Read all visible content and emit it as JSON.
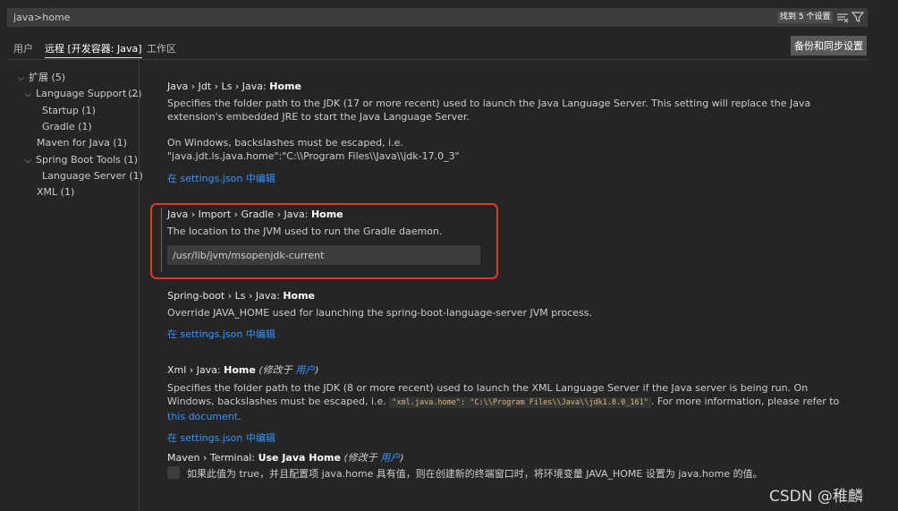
{
  "search": {
    "value": "java>home",
    "result_count": "找到 5 个设置",
    "clear_filter_icon": "clear-filter-icon",
    "filter_icon": "filter-icon"
  },
  "tabs": [
    {
      "label": "用户",
      "active": false
    },
    {
      "label": "远程 [开发容器: Java]",
      "active": true
    },
    {
      "label": "工作区",
      "active": false
    }
  ],
  "sync_button": "备份和同步设置",
  "toc": [
    {
      "label": "扩展 (5)",
      "chevron": "⌵"
    },
    {
      "label": "Language Support ...",
      "count": "(2)",
      "chevron": "⌵"
    },
    {
      "label": "Startup (1)",
      "chevron": ""
    },
    {
      "label": "Gradle (1)",
      "chevron": ""
    },
    {
      "label": "Maven for Java (1)",
      "chevron": ""
    },
    {
      "label": "Spring Boot Tools (1)",
      "chevron": "⌵"
    },
    {
      "label": "Language Server (1)",
      "chevron": ""
    },
    {
      "label": "XML (1)",
      "chevron": ""
    }
  ],
  "settings": {
    "jdt": {
      "category": "Java › Jdt › Ls › Java: ",
      "name": "Home",
      "desc1": "Specifies the folder path to the JDK (17 or more recent) used to launch the Java Language Server. This setting will replace the Java extension's embedded JRE to start the Java Language Server.",
      "desc2": "On Windows, backslashes must be escaped, i.e.",
      "desc3": "\"java.jdt.ls.java.home\":\"C:\\\\Program Files\\\\Java\\\\jdk-17.0_3\"",
      "link": "在 settings.json 中编辑"
    },
    "gradle": {
      "category": "Java › Import › Gradle › Java: ",
      "name": "Home",
      "desc": "The location to the JVM used to run the Gradle daemon.",
      "value": "/usr/lib/jvm/msopenjdk-current"
    },
    "spring": {
      "category": "Spring-boot › Ls › Java: ",
      "name": "Home",
      "desc": "Override JAVA_HOME used for launching the spring-boot-language-server JVM process.",
      "link": "在 settings.json 中编辑"
    },
    "xml": {
      "category": "Xml › Java: ",
      "name": "Home",
      "modified_prefix": "(修改于 ",
      "modified_link": "用户",
      "modified_suffix": ")",
      "desc_a": "Specifies the folder path to the JDK (8 or more recent) used to launch the XML Language Server if the Java server is being run. On Windows, backslashes must be escaped, i.e. ",
      "code": "\"xml.java.home\": \"C:\\\\Program Files\\\\Java\\\\jdk1.8.0_161\"",
      "desc_b": ". For more information, please refer to ",
      "doc_link": "this document",
      "desc_c": ".",
      "link": "在 settings.json 中编辑"
    },
    "maven": {
      "category": "Maven › Terminal: ",
      "name": "Use Java Home",
      "modified_prefix": "(修改于 ",
      "modified_link": "用户",
      "modified_suffix": ")",
      "checkbox_label": "如果此值为 true，并且配置项 java.home 具有值，则在创建新的终端窗口时，将环境变量 JAVA_HOME 设置为 java.home 的值。",
      "checked": false
    }
  },
  "watermark": "CSDN @稚麟",
  "colors": {
    "highlight": "#e0382b",
    "link": "#3794ff",
    "focus": "#007acc"
  }
}
